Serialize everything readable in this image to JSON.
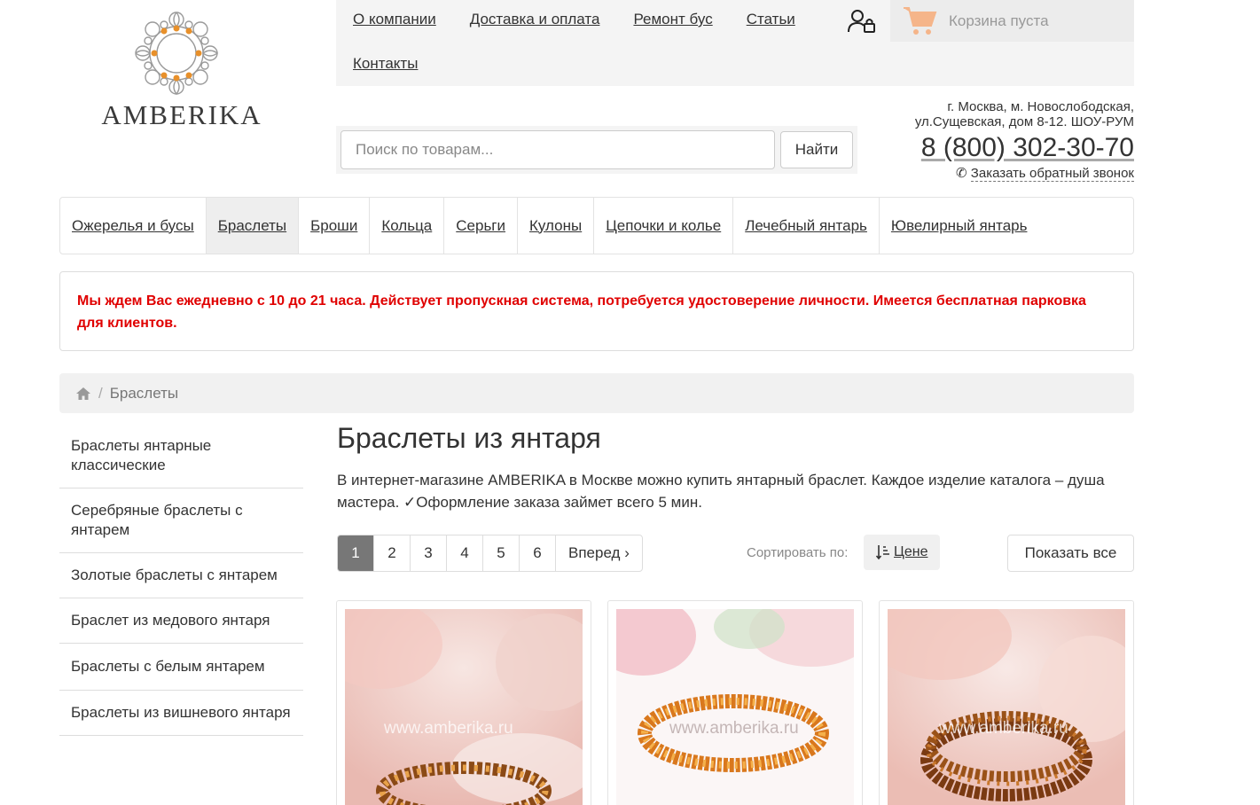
{
  "logo": {
    "text": "AMBERIKA"
  },
  "topnav": {
    "links": [
      "О компании",
      "Доставка и оплата",
      "Ремонт бус",
      "Статьи",
      "Контакты"
    ]
  },
  "cart": {
    "label": "Корзина пуста"
  },
  "search": {
    "placeholder": "Поиск по товарам...",
    "button": "Найти"
  },
  "contacts": {
    "address_line1": "г. Москва, м. Новослободская,",
    "address_line2": "ул.Сущевская, дом 8-12. ШОУ-РУМ",
    "phone": "8 (800) 302-30-70",
    "callback": "Заказать обратный звонок"
  },
  "categories": [
    {
      "label": "Ожерелья и бусы",
      "active": false
    },
    {
      "label": "Браслеты",
      "active": true
    },
    {
      "label": "Броши",
      "active": false
    },
    {
      "label": "Кольца",
      "active": false
    },
    {
      "label": "Серьги",
      "active": false
    },
    {
      "label": "Кулоны",
      "active": false
    },
    {
      "label": "Цепочки и колье",
      "active": false
    },
    {
      "label": "Лечебный янтарь",
      "active": false
    },
    {
      "label": "Ювелирный янтарь",
      "active": false
    }
  ],
  "notice": {
    "text": "Мы ждем Вас ежедневно с 10 до 21 часа. Действует пропускная система, потребуется удостоверение личности. Имеется бесплатная парковка для клиентов."
  },
  "breadcrumb": {
    "current": "Браслеты",
    "separator": "/"
  },
  "sidebar": {
    "items": [
      "Браслеты янтарные классические",
      "Серебряные браслеты с янтарем",
      "Золотые браслеты с янтарем",
      "Браслет из медового янтаря",
      "Браслеты с белым янтарем",
      "Браслеты из вишневого янтаря"
    ]
  },
  "main": {
    "title": "Браслеты из янтаря",
    "intro": "В интернет-магазине AMBERIKA в Москве можно купить янтарный браслет. Каждое изделие каталога – душа мастера. ✓Оформление заказа займет всего 5 мин."
  },
  "pager": {
    "pages": [
      "1",
      "2",
      "3",
      "4",
      "5",
      "6"
    ],
    "current": "1",
    "next": "Вперед"
  },
  "sort": {
    "label": "Сортировать по:",
    "value": "Цене"
  },
  "show_all": "Показать все",
  "products": {
    "watermark": "www.amberika.ru"
  },
  "colors": {
    "notice_text": "#e00000",
    "active_page": "#777777",
    "amber": "#e8902a"
  }
}
